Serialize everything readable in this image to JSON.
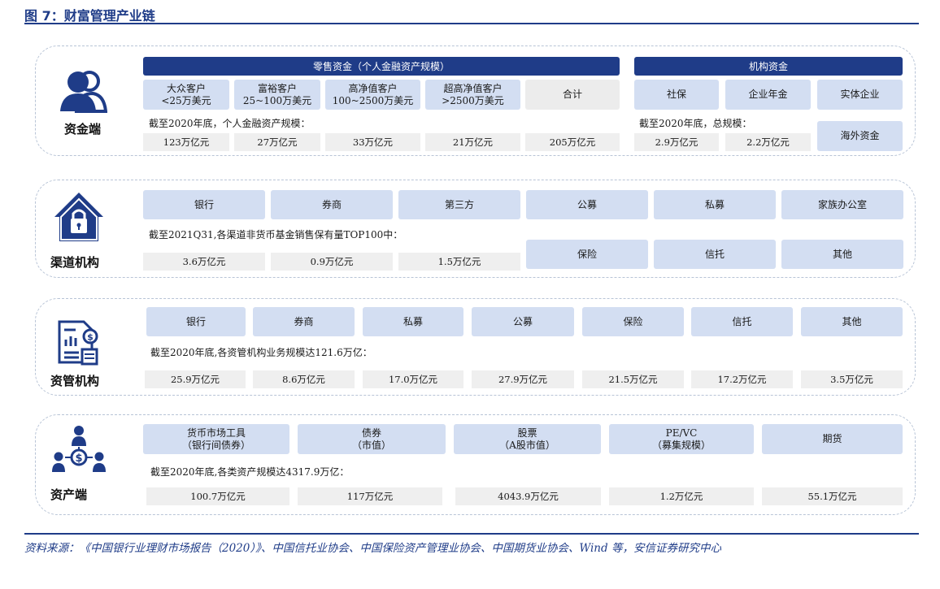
{
  "title": "图 7：财富管理产业链",
  "source": "资料来源：《中国银行业理财市场报告（2020）》、中国信托业协会、中国保险资产管理业协会、中国期货业协会、Wind 等，安信证券研究中心",
  "funds": {
    "label": "资金端",
    "retail_header": "零售资金（个人金融资产规模）",
    "inst_header": "机构资金",
    "retail_items": [
      {
        "l1": "大众客户",
        "l2": "<25万美元"
      },
      {
        "l1": "富裕客户",
        "l2": "25~100万美元"
      },
      {
        "l1": "高净值客户",
        "l2": "100~2500万美元"
      },
      {
        "l1": "超高净值客户",
        "l2": ">2500万美元"
      },
      {
        "l1": "合计",
        "l2": ""
      }
    ],
    "inst_items": [
      "社保",
      "企业年金",
      "实体企业"
    ],
    "overseas": "海外资金",
    "retail_note": "截至2020年底，个人金融资产规模：",
    "inst_note": "截至2020年底，总规模：",
    "retail_values": [
      "123万亿元",
      "27万亿元",
      "33万亿元",
      "21万亿元",
      "205万亿元"
    ],
    "inst_values": [
      "2.9万亿元",
      "2.2万亿元"
    ]
  },
  "channels": {
    "label": "渠道机构",
    "items": [
      "银行",
      "券商",
      "第三方",
      "公募",
      "私募",
      "家族办公室"
    ],
    "note": "截至2021Q31,各渠道非货币基金销售保有量TOP100中：",
    "values": [
      "3.6万亿元",
      "0.9万亿元",
      "1.5万亿元"
    ],
    "extra": [
      "保险",
      "信托",
      "其他"
    ]
  },
  "am": {
    "label": "资管机构",
    "items": [
      "银行",
      "券商",
      "私募",
      "公募",
      "保险",
      "信托",
      "其他"
    ],
    "note": "截至2020年底,各资管机构业务规模达121.6万亿：",
    "values": [
      "25.9万亿元",
      "8.6万亿元",
      "17.0万亿元",
      "27.9万亿元",
      "21.5万亿元",
      "17.2万亿元",
      "3.5万亿元"
    ]
  },
  "assets": {
    "label": "资产端",
    "items": [
      {
        "l1": "货币市场工具",
        "l2": "（银行间债券）"
      },
      {
        "l1": "债券",
        "l2": "（市值）"
      },
      {
        "l1": "股票",
        "l2": "（A股市值）"
      },
      {
        "l1": "PE/VC",
        "l2": "（募集规模）"
      },
      {
        "l1": "期货",
        "l2": ""
      }
    ],
    "note": "截至2020年底,各类资产规模达4317.9万亿：",
    "values": [
      "100.7万亿元",
      "117万亿元",
      "4043.9万亿元",
      "1.2万亿元",
      "55.1万亿元"
    ]
  }
}
